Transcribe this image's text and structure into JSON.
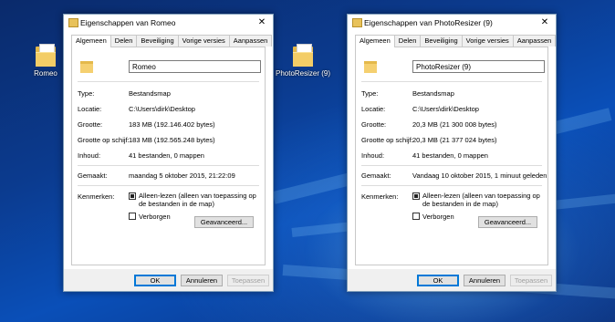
{
  "desktop": {
    "icons": [
      {
        "label": "Romeo"
      },
      {
        "label": "PhotoResizer (9)"
      }
    ]
  },
  "windows": [
    {
      "title": "Eigenschappen van Romeo",
      "close_symbol": "✕",
      "tabs": [
        "Algemeen",
        "Delen",
        "Beveiliging",
        "Vorige versies",
        "Aanpassen"
      ],
      "name": "Romeo",
      "fields": [
        {
          "label": "Type:",
          "value": "Bestandsmap"
        },
        {
          "label": "Locatie:",
          "value": "C:\\Users\\dirk\\Desktop"
        },
        {
          "label": "Grootte:",
          "value": "183 MB (192.146.402 bytes)"
        },
        {
          "label": "Grootte op schijf:",
          "value": "183 MB (192.565.248 bytes)"
        },
        {
          "label": "Inhoud:",
          "value": "41 bestanden, 0 mappen"
        }
      ],
      "created_label": "Gemaakt:",
      "created_value": "maandag 5 oktober 2015, 21:22:09",
      "attributes_label": "Kenmerken:",
      "readonly_label": "Alleen-lezen (alleen van toepassing op de bestanden in de map)",
      "readonly_checked": true,
      "hidden_label": "Verborgen",
      "hidden_checked": false,
      "advanced_button": "Geavanceerd...",
      "ok_button": "OK",
      "cancel_button": "Annuleren",
      "apply_button": "Toepassen"
    },
    {
      "title": "Eigenschappen van PhotoResizer (9)",
      "close_symbol": "✕",
      "tabs": [
        "Algemeen",
        "Delen",
        "Beveiliging",
        "Vorige versies",
        "Aanpassen"
      ],
      "name": "PhotoResizer (9)",
      "fields": [
        {
          "label": "Type:",
          "value": "Bestandsmap"
        },
        {
          "label": "Locatie:",
          "value": "C:\\Users\\dirk\\Desktop"
        },
        {
          "label": "Grootte:",
          "value": "20,3 MB (21 300 008 bytes)"
        },
        {
          "label": "Grootte op schijf:",
          "value": "20,3 MB (21 377 024 bytes)"
        },
        {
          "label": "Inhoud:",
          "value": "41 bestanden, 0 mappen"
        }
      ],
      "created_label": "Gemaakt:",
      "created_value": "Vandaag 10 oktober 2015, 1 minuut geleden",
      "attributes_label": "Kenmerken:",
      "readonly_label": "Alleen-lezen (alleen van toepassing op de bestanden in de map)",
      "readonly_checked": true,
      "hidden_label": "Verborgen",
      "hidden_checked": false,
      "advanced_button": "Geavanceerd...",
      "ok_button": "OK",
      "cancel_button": "Annuleren",
      "apply_button": "Toepassen"
    }
  ]
}
